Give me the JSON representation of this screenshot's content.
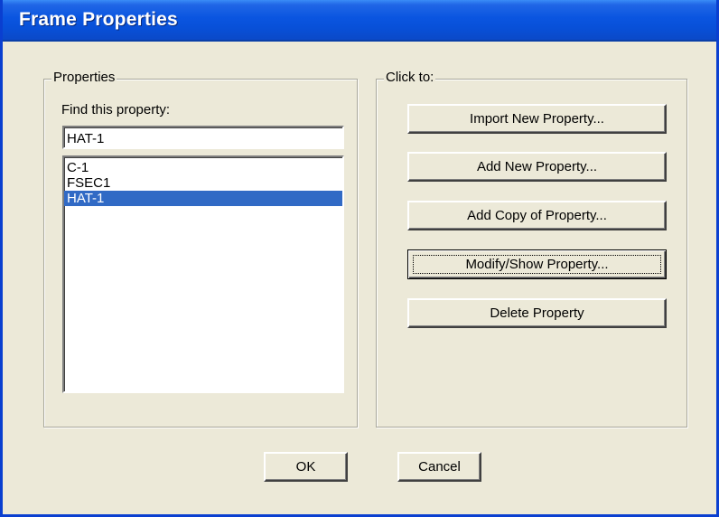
{
  "window": {
    "title": "Frame Properties"
  },
  "properties_group": {
    "legend": "Properties",
    "find_label": "Find this property:",
    "find_value": "HAT-1",
    "items": [
      "C-1",
      "FSEC1",
      "HAT-1"
    ],
    "selected_item": "HAT-1"
  },
  "click_group": {
    "legend": "Click to:",
    "import_label": "Import New Property...",
    "add_label": "Add New Property...",
    "copy_label": "Add Copy of Property...",
    "modify_label": "Modify/Show Property...",
    "delete_label": "Delete Property"
  },
  "footer": {
    "ok_label": "OK",
    "cancel_label": "Cancel"
  },
  "colors": {
    "title_bar": "#0a55e0",
    "selection": "#316ac5",
    "face": "#ece9d8"
  }
}
